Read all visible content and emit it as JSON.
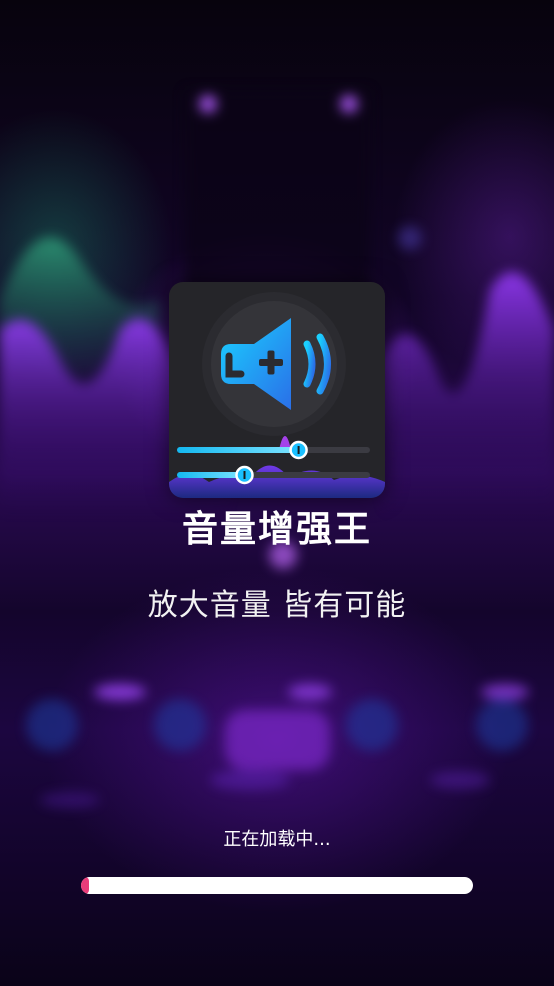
{
  "app": {
    "title": "音量增强王",
    "slogan": "放大音量 皆有可能"
  },
  "logo": {
    "icon": "speaker-plus-icon",
    "slider_1_level": 0.63,
    "slider_2_level": 0.35
  },
  "loading": {
    "text": "正在加载中...",
    "progress": 0.02
  },
  "colors": {
    "accent_progress": "#e93c7a",
    "track": "#ffffff",
    "logo_bg": "#252529",
    "icon_gradient_start": "#1ad0ff",
    "icon_gradient_end": "#2a6fe8",
    "background_purple": "#5a14b4"
  }
}
